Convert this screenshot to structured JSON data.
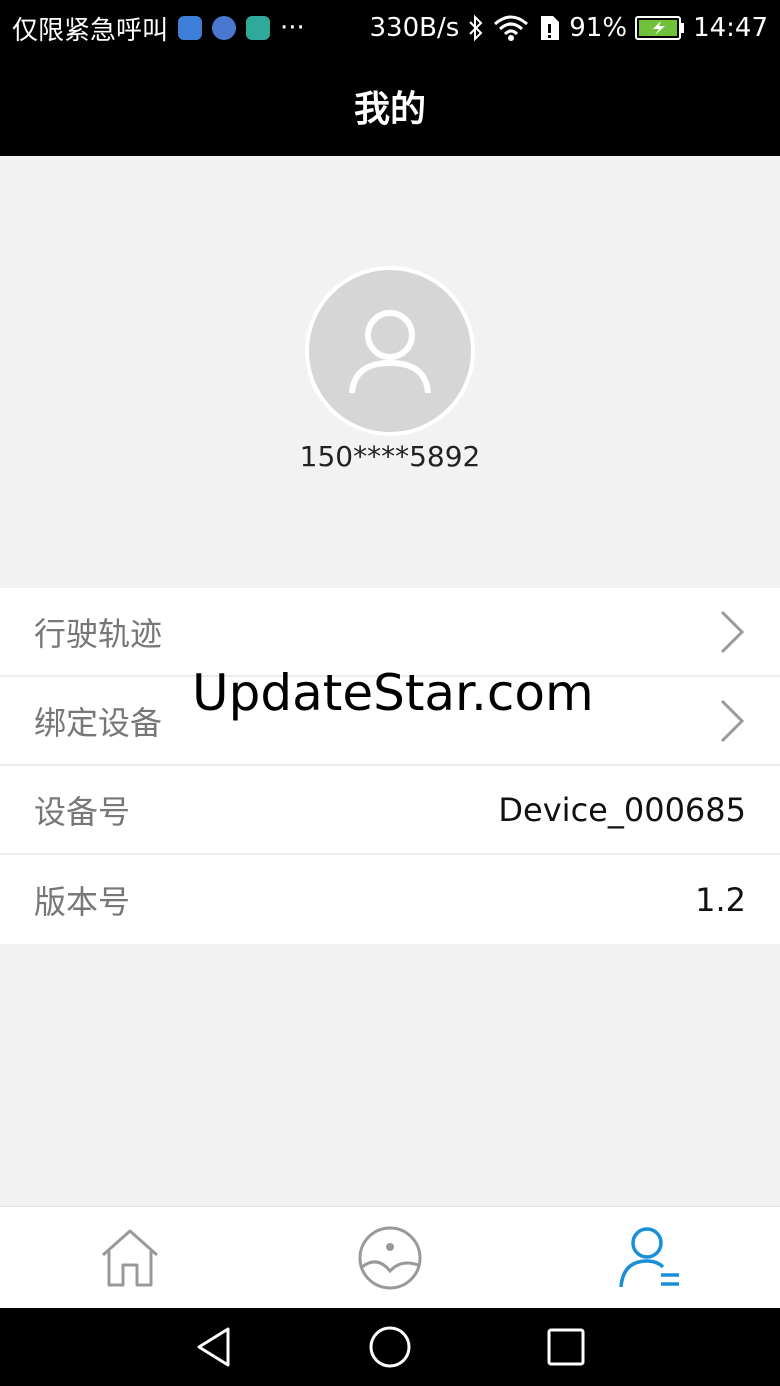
{
  "status_bar": {
    "carrier": "仅限紧急呼叫",
    "more": "···",
    "net_speed": "330B/s",
    "battery": "91%",
    "time": "14:47",
    "notif_colors": [
      "#3d7fd6",
      "#4a78d0",
      "#2fa99a"
    ]
  },
  "header": {
    "title": "我的"
  },
  "profile": {
    "phone": "150****5892"
  },
  "menu": [
    {
      "label": "行驶轨迹",
      "value": "",
      "chevron": true
    },
    {
      "label": "绑定设备",
      "value": "",
      "chevron": true
    },
    {
      "label": "设备号",
      "value": "Device_000685",
      "chevron": false
    },
    {
      "label": "版本号",
      "value": "1.2",
      "chevron": false
    }
  ],
  "watermark": "UpdateStar.com",
  "bottom_nav": {
    "active": "profile",
    "accent": "#1a8fd8",
    "items": [
      "home-icon",
      "explore-icon",
      "profile-icon"
    ]
  }
}
